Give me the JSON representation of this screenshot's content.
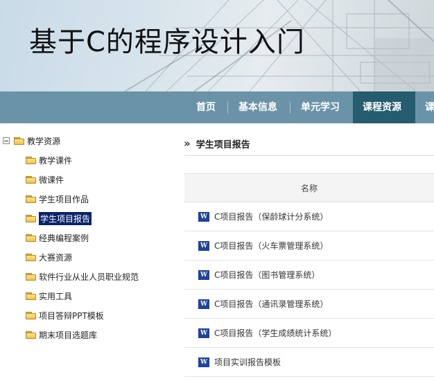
{
  "banner": {
    "title": "基于C的程序设计入门"
  },
  "nav": {
    "items": [
      {
        "label": "首页"
      },
      {
        "label": "基本信息"
      },
      {
        "label": "单元学习"
      },
      {
        "label": "课程资源",
        "active": true
      },
      {
        "label": "课"
      }
    ]
  },
  "tree": {
    "root": {
      "label": "教学资源"
    },
    "items": [
      {
        "label": "教学课件"
      },
      {
        "label": "微课件"
      },
      {
        "label": "学生项目作品"
      },
      {
        "label": "学生项目报告",
        "selected": true
      },
      {
        "label": "经典编程案例"
      },
      {
        "label": "大赛资源"
      },
      {
        "label": "软件行业从业人员职业规范"
      },
      {
        "label": "实用工具"
      },
      {
        "label": "项目答辩PPT模板"
      },
      {
        "label": "期末项目选题库"
      }
    ]
  },
  "content": {
    "title": "学生项目报告",
    "table": {
      "header": "名称",
      "rows": [
        {
          "label": "C项目报告（保龄球计分系统）"
        },
        {
          "label": "C项目报告（火车票管理系统）"
        },
        {
          "label": "C项目报告（图书管理系统）"
        },
        {
          "label": "C项目报告（通讯录管理系统）"
        },
        {
          "label": "C项目报告（学生成绩统计系统）"
        },
        {
          "label": "项目实训报告模板"
        }
      ]
    }
  },
  "icons": {
    "folder": "folder-icon",
    "word": "word-document-icon",
    "collapse": "tree-collapse-icon",
    "chevron": "double-chevron-right-icon"
  },
  "colors": {
    "nav_bg": "#6b93a7",
    "nav_active": "#255c6e",
    "selected_bg": "#0a246a"
  }
}
